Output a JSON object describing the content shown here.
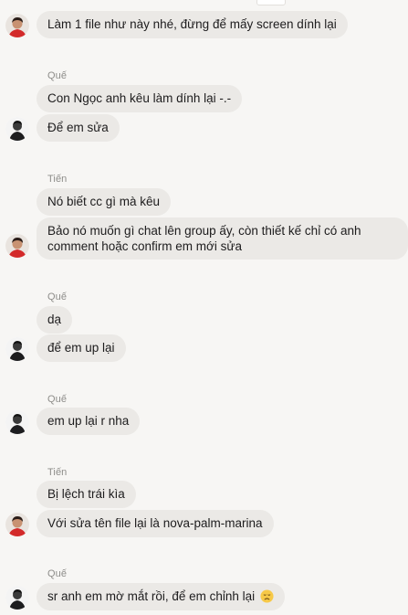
{
  "messages": [
    {
      "text": "Làm 1 file như này nhé, đừng để mấy screen dính lại"
    },
    {
      "sender": "Quế",
      "text": "Con Ngọc anh kêu làm dính lại -.-"
    },
    {
      "text": "Để em sửa"
    },
    {
      "sender": "Tiến",
      "text": "Nó biết cc gì mà kêu"
    },
    {
      "text": "Bảo nó muốn gì chat lên group ấy, còn thiết kế chỉ có anh comment hoặc confirm em mới sửa"
    },
    {
      "sender": "Quế",
      "text": "dạ"
    },
    {
      "text": "để em up lại"
    },
    {
      "sender": "Quế",
      "text": "em up lại r nha"
    },
    {
      "sender": "Tiến",
      "text": "Bị lệch trái kìa"
    },
    {
      "text": "Với sửa tên file lại là nova-palm-marina"
    },
    {
      "sender": "Quế",
      "text": "sr anh em mờ mắt rồi, để em chỉnh lại"
    }
  ],
  "icons": {
    "avatar_tien": "avatar-red-shirt",
    "avatar_que": "avatar-dark-person",
    "emoji": "disappointed-face-emoji"
  },
  "colors": {
    "background": "#f7f6f4",
    "bubble": "#ebe9e6",
    "sender_name": "#8e8d8a",
    "text": "#1d1c1d"
  }
}
